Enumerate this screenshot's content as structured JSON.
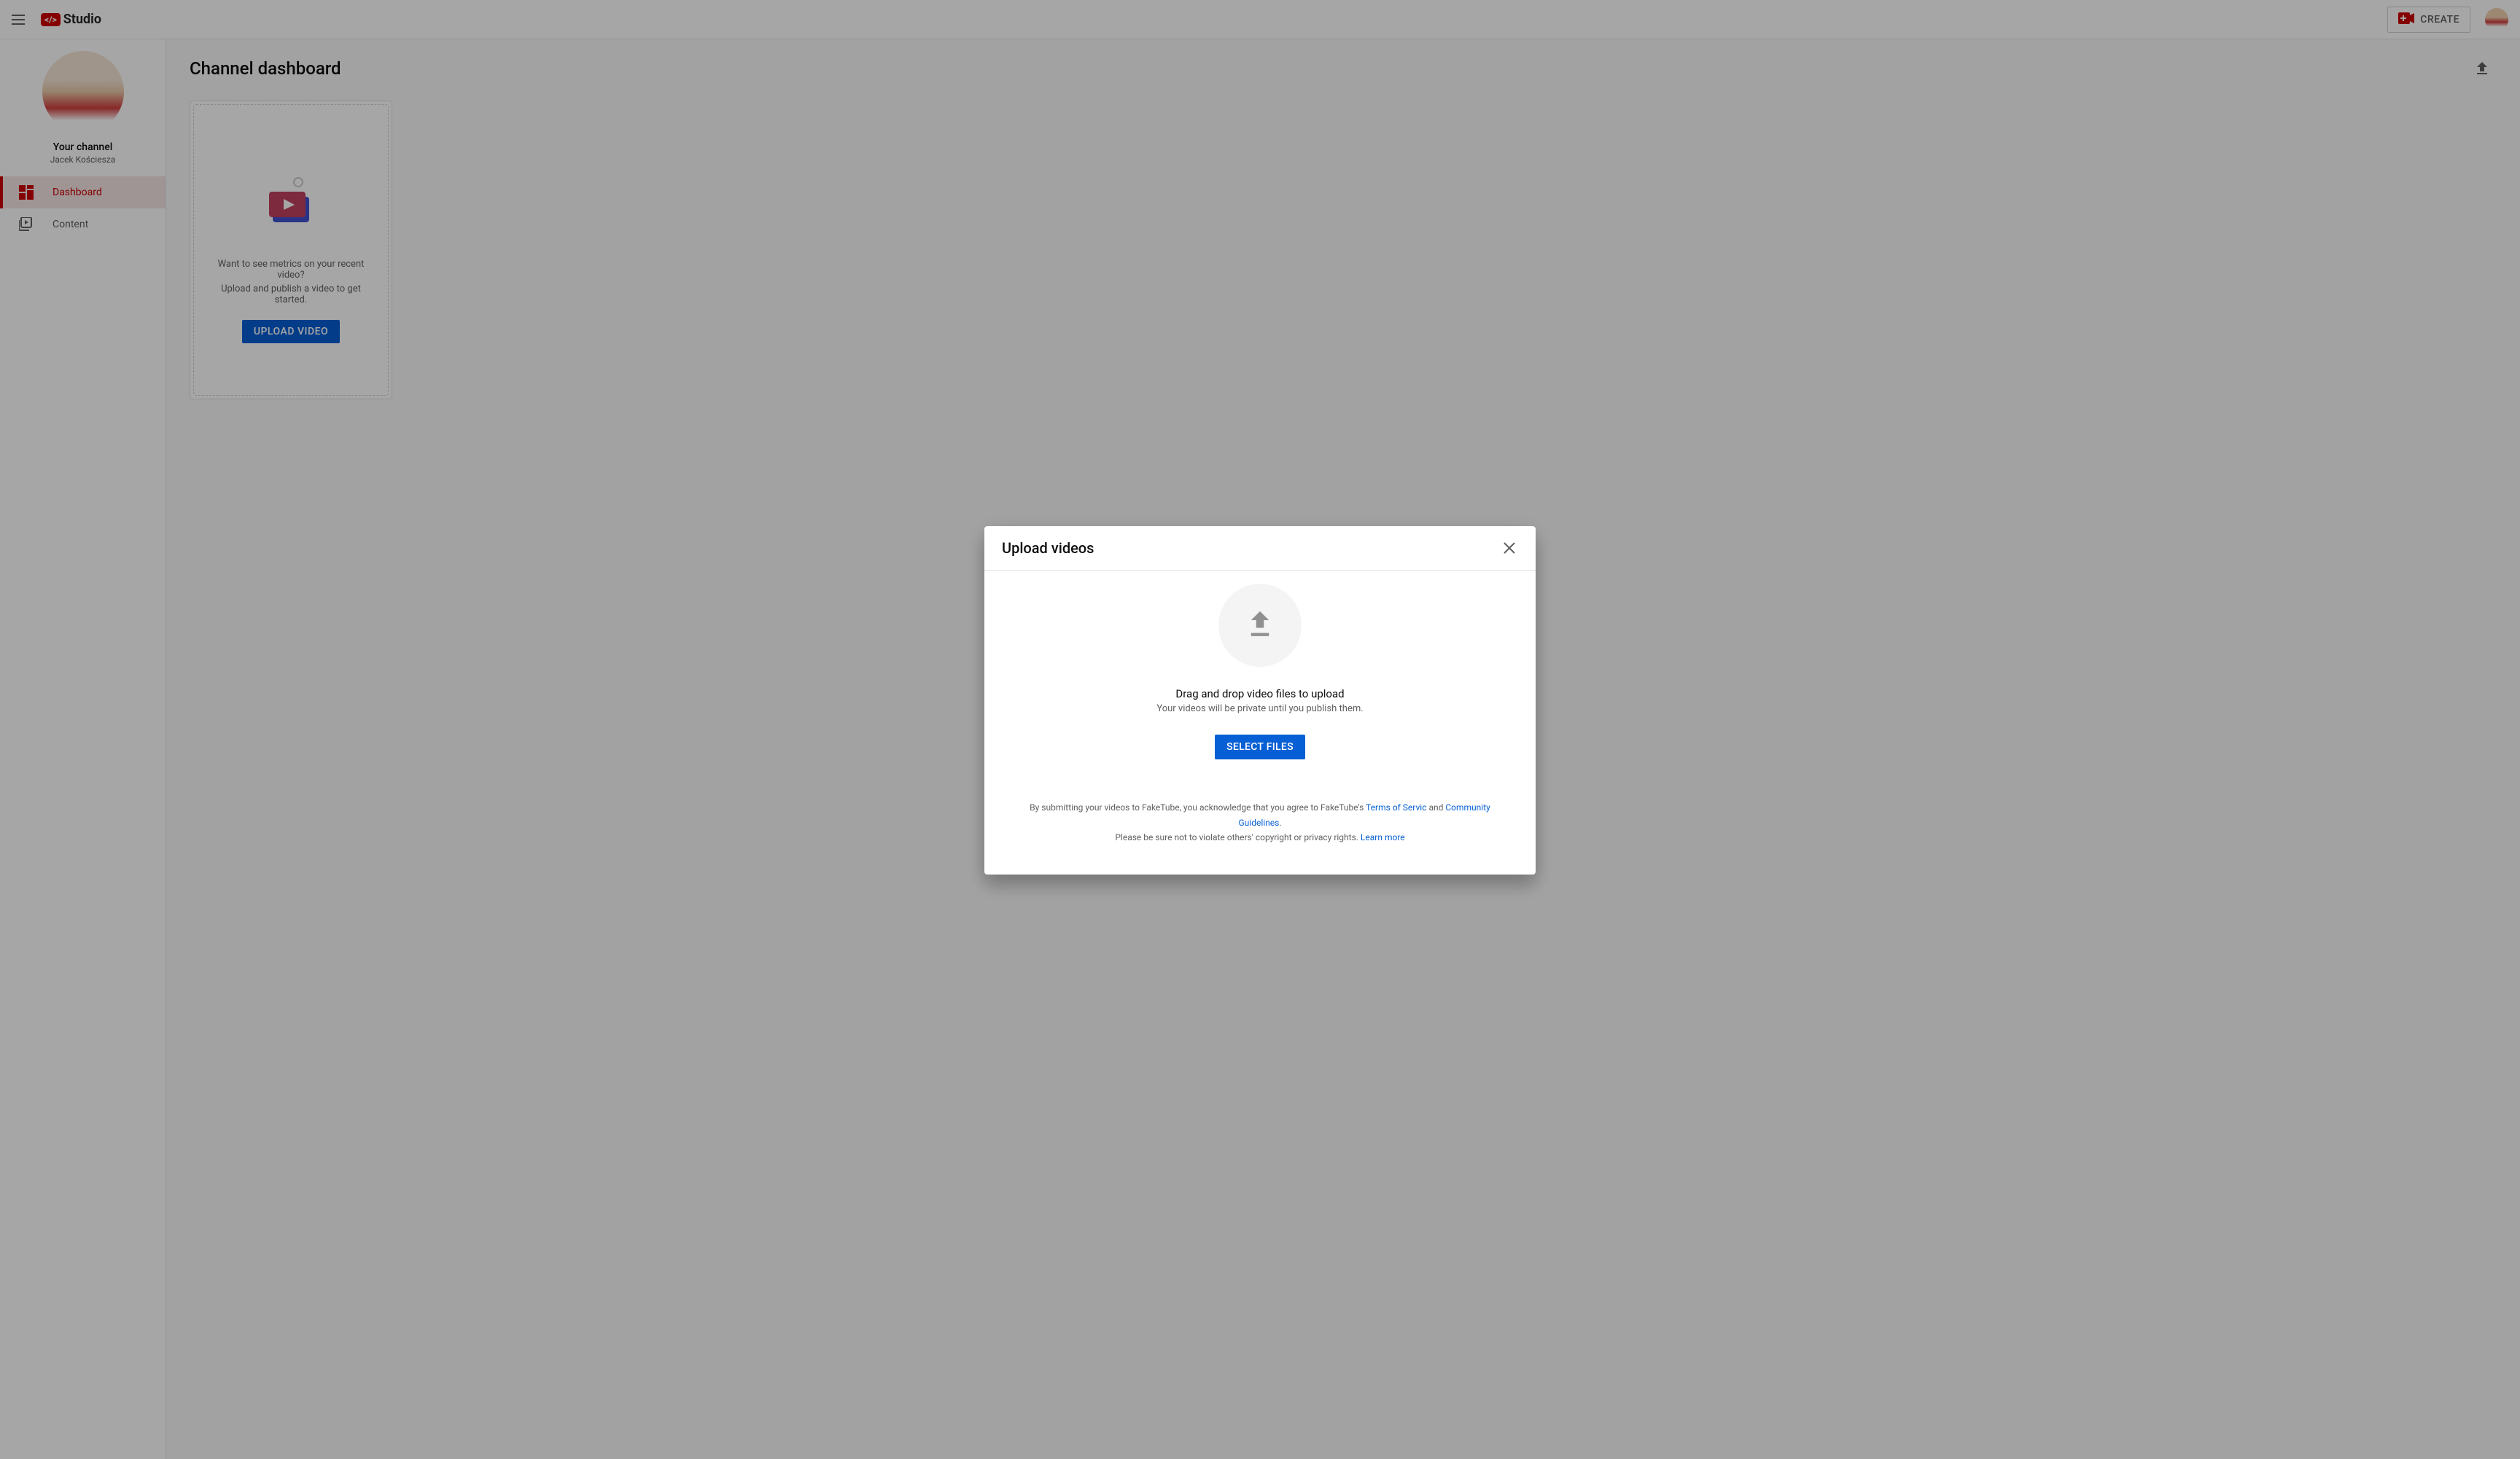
{
  "header": {
    "logo_text": "Studio",
    "create_label": "CREATE"
  },
  "sidebar": {
    "channel_title": "Your channel",
    "channel_name": "Jacek Kościesza",
    "items": [
      {
        "label": "Dashboard",
        "active": true
      },
      {
        "label": "Content",
        "active": false
      }
    ]
  },
  "page": {
    "title": "Channel dashboard",
    "card": {
      "line1": "Want to see metrics on your recent video?",
      "line2": "Upload and publish a video to get started.",
      "button_label": "UPLOAD VIDEO"
    }
  },
  "modal": {
    "title": "Upload videos",
    "drag_text": "Drag and drop video files to upload",
    "private_text": "Your videos will be private until you publish them.",
    "select_button": "SELECT FILES",
    "disclaimer": {
      "part1": "By submitting your videos to FakeTube, you acknowledge that you agree to FakeTube's ",
      "link1": "Terms of Servic",
      "part2": " and ",
      "link2": "Community Guidelines",
      "part3": ".",
      "part4": "Please be sure not to violate others' copyright or privacy rights. ",
      "link3": "Learn more"
    }
  }
}
